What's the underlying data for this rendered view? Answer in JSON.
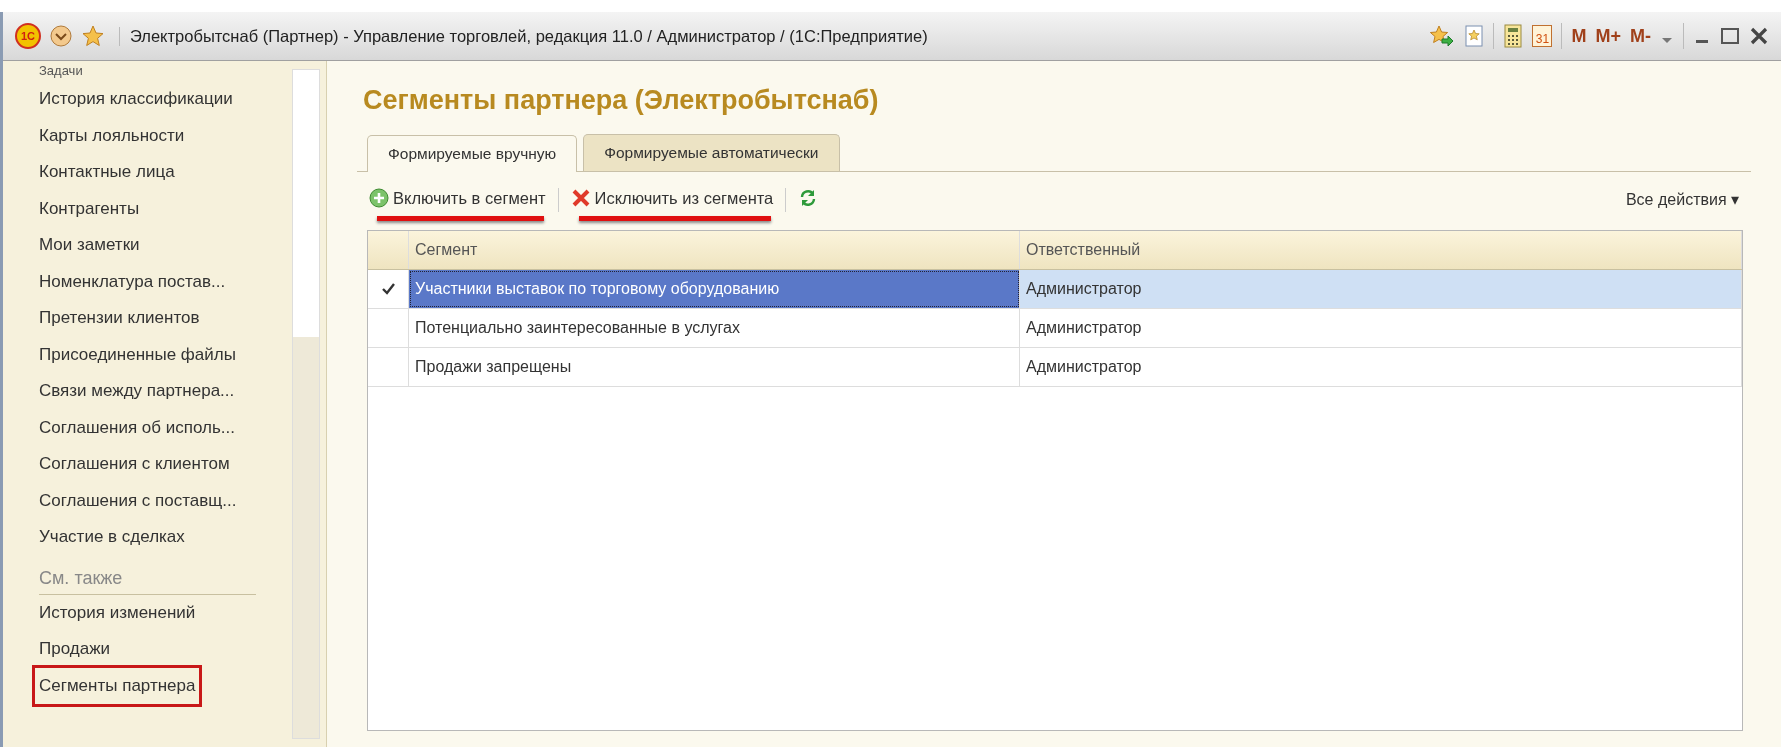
{
  "window": {
    "title": "Электробытснаб (Партнер) - Управление торговлей, редакция 11.0 / Администратор /  (1С:Предприятие)",
    "logo": "1С",
    "calendar_day": "31",
    "memory_buttons": [
      "M",
      "M+",
      "M-"
    ]
  },
  "sidebar": {
    "items": [
      {
        "label": "Задачи",
        "highlighted": false
      },
      {
        "label": "История классификации",
        "highlighted": false
      },
      {
        "label": "Карты лояльности",
        "highlighted": false
      },
      {
        "label": "Контактные лица",
        "highlighted": false
      },
      {
        "label": "Контрагенты",
        "highlighted": false
      },
      {
        "label": "Мои заметки",
        "highlighted": false
      },
      {
        "label": "Номенклатура постав...",
        "highlighted": false
      },
      {
        "label": "Претензии клиентов",
        "highlighted": false
      },
      {
        "label": "Присоединенные файлы",
        "highlighted": false
      },
      {
        "label": "Связи между партнера...",
        "highlighted": false
      },
      {
        "label": "Соглашения об исполь...",
        "highlighted": false
      },
      {
        "label": "Соглашения с клиентом",
        "highlighted": false
      },
      {
        "label": "Соглашения с поставщ...",
        "highlighted": false
      },
      {
        "label": "Участие в сделках",
        "highlighted": false
      }
    ],
    "see_also": {
      "heading": "См. также",
      "items": [
        {
          "label": "История изменений",
          "highlighted": false
        },
        {
          "label": "Продажи",
          "highlighted": false
        },
        {
          "label": "Сегменты партнера",
          "highlighted": true
        }
      ]
    }
  },
  "form": {
    "title": "Сегменты партнера (Электробытснаб)",
    "tabs": [
      {
        "label": "Формируемые вручную",
        "selected": true
      },
      {
        "label": "Формируемые автоматически",
        "selected": false
      }
    ],
    "toolbar": [
      {
        "kind": "add",
        "label": "Включить в сегмент",
        "underlined": true
      },
      {
        "kind": "remove",
        "label": "Исключить из сегмента",
        "underlined": true
      },
      {
        "kind": "refresh",
        "underlined": false
      }
    ],
    "all_actions": "Все действия ▾",
    "table": {
      "columns": [
        "Сегмент",
        "Ответственный"
      ],
      "rows": [
        {
          "checked": true,
          "selected": true,
          "cells": [
            "Участники выставок по торговому оборудованию",
            "Администратор"
          ]
        },
        {
          "checked": false,
          "selected": false,
          "cells": [
            "Потенциально заинтересованные в услугах",
            "Администратор"
          ]
        },
        {
          "checked": false,
          "selected": false,
          "cells": [
            "Продажи запрещены",
            "Администратор"
          ]
        }
      ]
    }
  }
}
